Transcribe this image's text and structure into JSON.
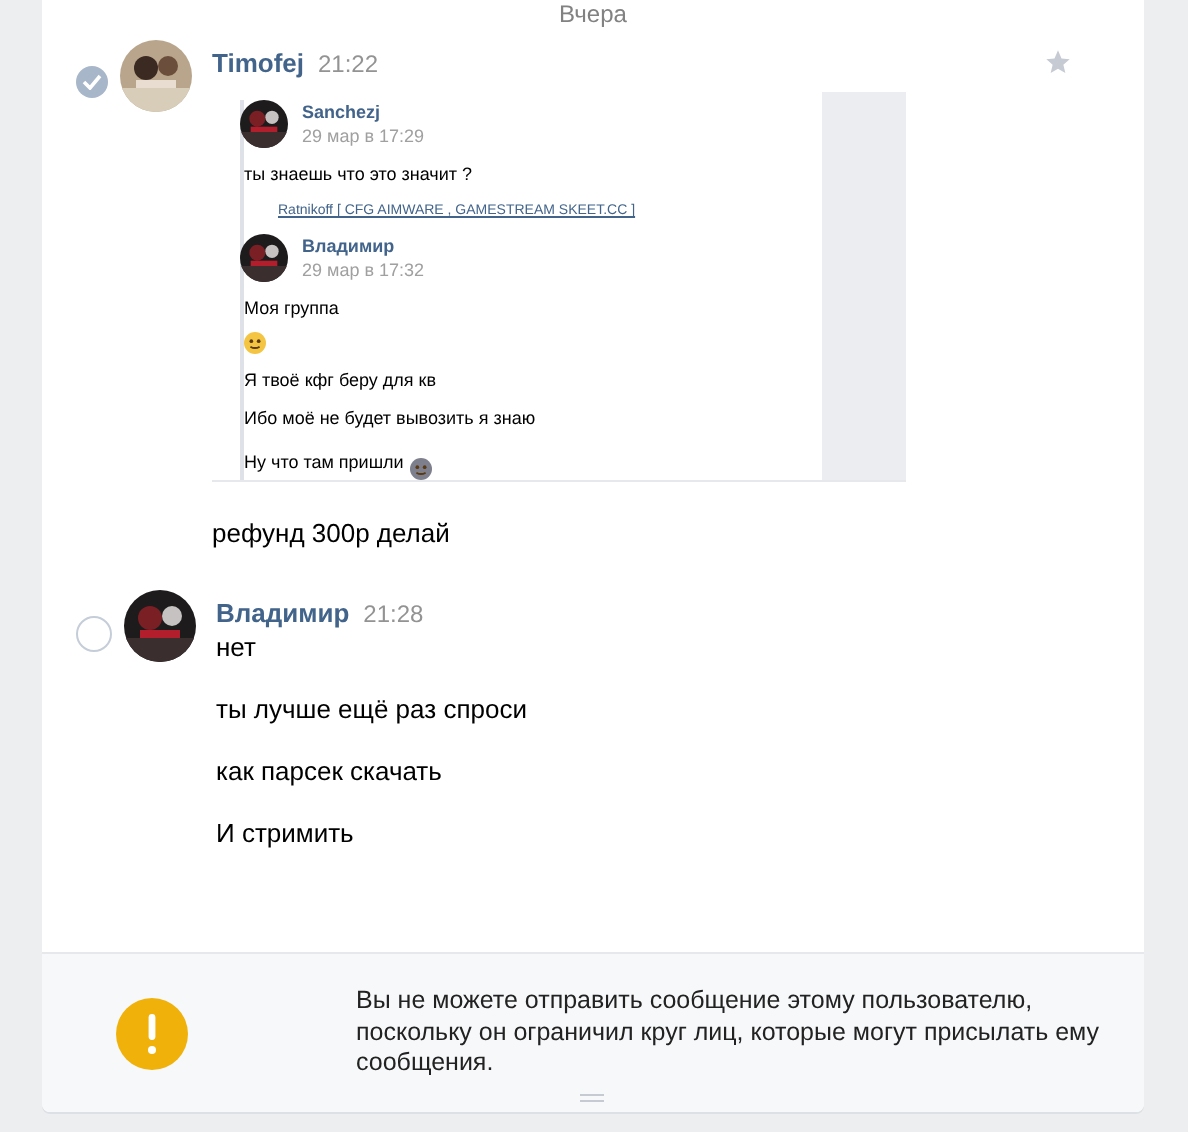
{
  "day_divider": "Вчера",
  "messages": [
    {
      "author": "Timofej",
      "time": "21:22",
      "selected": true,
      "starred": false,
      "avatar": {
        "kind": "picture"
      },
      "forwarded": [
        {
          "author": "Sanchezj",
          "date": "29 мар в 17:29",
          "lines": [
            {
              "kind": "text",
              "text": "ты знаешь что это значит ?"
            },
            {
              "kind": "link",
              "text": "Ratnikoff [ CFG AIMWARE , GAMESTREAM SKEET.CC ]"
            }
          ]
        },
        {
          "author": "Владимир",
          "date": "29 мар в 17:32",
          "lines": [
            {
              "kind": "text",
              "text": "Моя группа"
            },
            {
              "kind": "emoji"
            },
            {
              "kind": "text",
              "text": "Я твоё кфг беру для кв"
            },
            {
              "kind": "text",
              "text": "Ибо моё не будет вывозить я знаю"
            },
            {
              "kind": "text_emoji",
              "text": "Ну что там пришли"
            }
          ]
        }
      ],
      "lines": [
        "рефунд 300р делай"
      ]
    },
    {
      "author": "Владимир",
      "time": "21:28",
      "selected": false,
      "avatar": {
        "kind": "picture"
      },
      "lines": [
        "нет",
        "ты лучше ещё раз спроси",
        "как парсек скачать",
        "И стримить"
      ]
    }
  ],
  "notice": {
    "text": "Вы не можете отправить сообщение этому пользователю, поскольку он ограничил круг лиц, которые могут присылать ему сообщения."
  }
}
